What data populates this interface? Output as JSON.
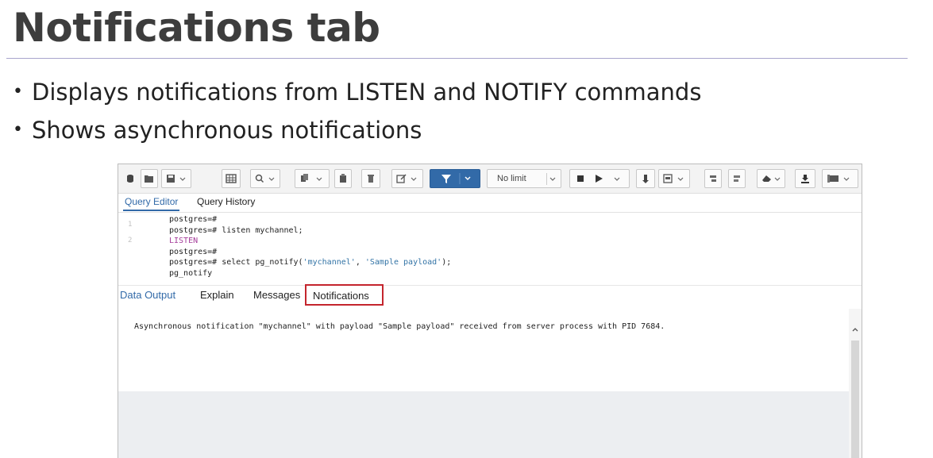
{
  "slide": {
    "title": "Notifications tab",
    "bullets": [
      "Displays notifications from LISTEN and NOTIFY commands",
      "Shows asynchronous notifications"
    ]
  },
  "toolbar": {
    "limit_value": "No limit",
    "accent_color": "#326aa8"
  },
  "editor_tabs": [
    "Query Editor",
    "Query History"
  ],
  "editor": {
    "gutter": [
      "1",
      "2"
    ],
    "lines": [
      "postgres=#",
      "postgres=# listen mychannel;",
      "LISTEN",
      "postgres=#",
      "postgres=# select pg_notify(",
      "'mychannel'",
      ", ",
      "'Sample payload'",
      ");",
      "pg_notify"
    ]
  },
  "result_tabs": [
    "Data Output",
    "Explain",
    "Messages",
    "Notifications"
  ],
  "output": {
    "message": "Asynchronous notification \"mychannel\" with payload \"Sample payload\" received from server process with PID 7684."
  },
  "highlight_color": "#c4252d"
}
